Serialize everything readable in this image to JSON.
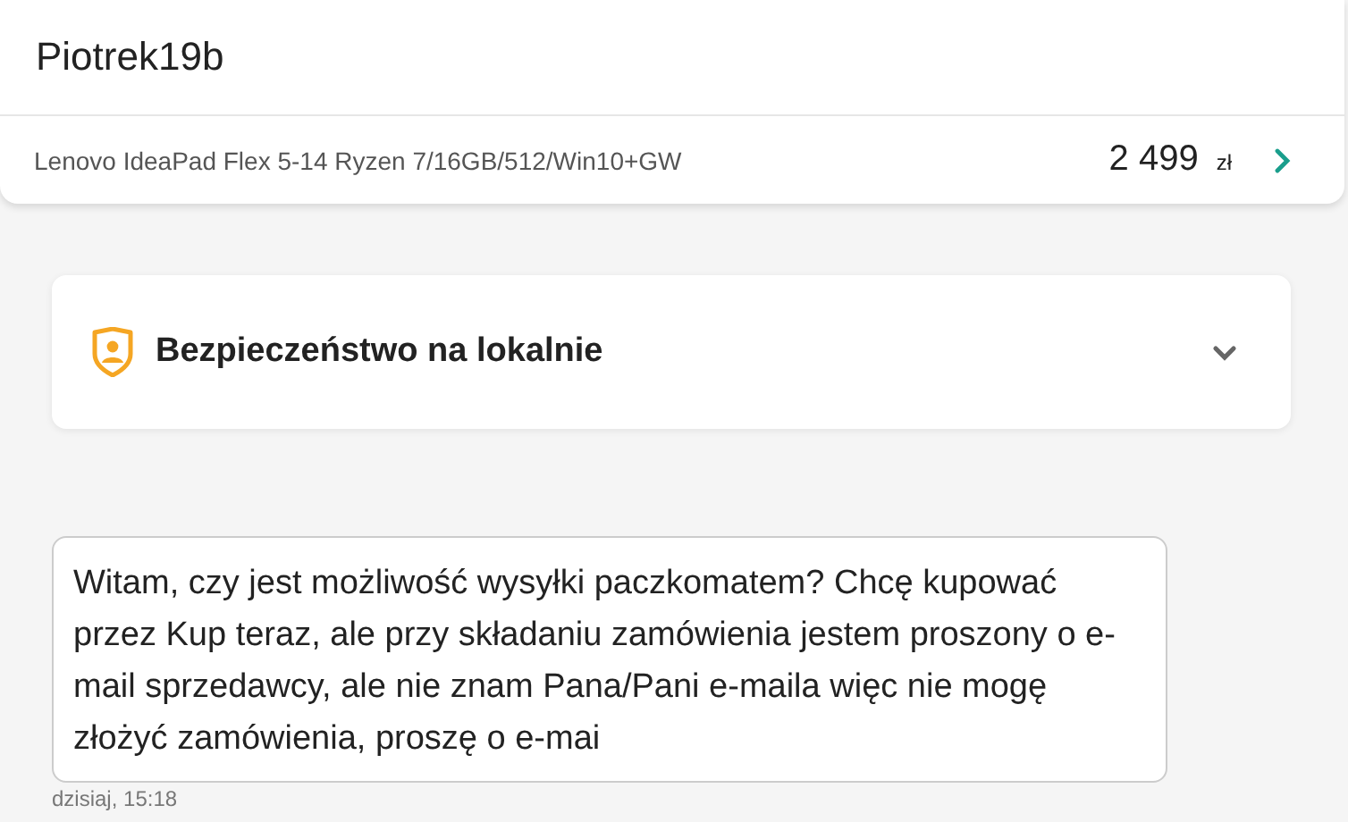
{
  "header": {
    "title": "Piotrek19b"
  },
  "offer": {
    "name": "Lenovo IdeaPad Flex 5-14 Ryzen 7/16GB/512/Win10+GW",
    "price": "2 499",
    "currency": "zł"
  },
  "safety_panel": {
    "title": "Bezpieczeństwo na lokalnie",
    "expanded": false
  },
  "messages": [
    {
      "text": "Witam, czy jest możliwość wysyłki paczkomatem? Chcę kupować przez Kup teraz, ale przy składaniu zamówienia jestem proszony o e-mail sprzedawcy, ale nie znam Pana/Pani e-maila więc nie mogę złożyć zamówienia, proszę o e-mai",
      "time": "dzisiaj, 15:18"
    }
  ]
}
